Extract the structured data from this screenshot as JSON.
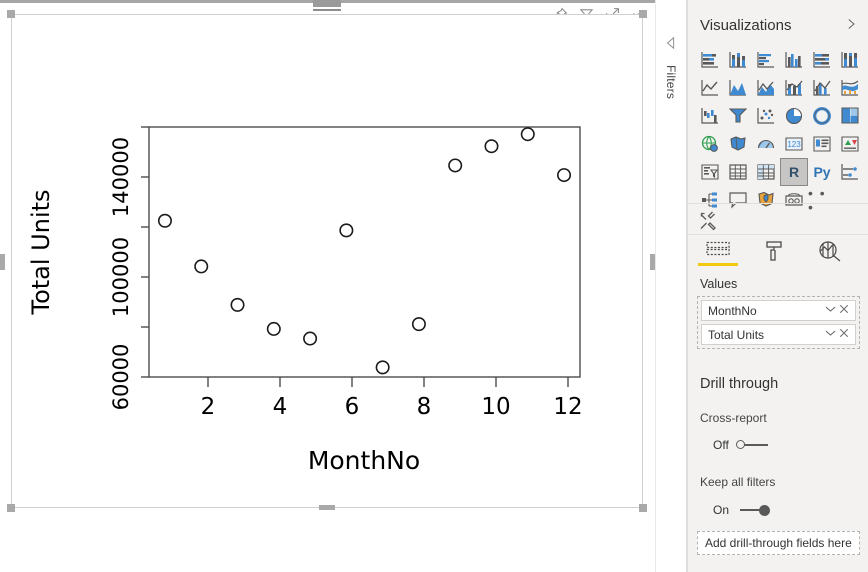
{
  "canvas": {
    "visual_header_icons": [
      "pin-icon",
      "filter-icon",
      "focus-mode-icon",
      "more-options-icon"
    ],
    "drag_handle": "drag-handle"
  },
  "filters_flyout": {
    "label": "Filters",
    "chevron": "chevron-left-icon"
  },
  "visualizations": {
    "title": "Visualizations",
    "collapse_icon": "chevron-right-icon",
    "gallery": [
      {
        "name": "stacked-bar-chart",
        "selected": false
      },
      {
        "name": "stacked-column-chart",
        "selected": false
      },
      {
        "name": "clustered-bar-chart",
        "selected": false
      },
      {
        "name": "clustered-column-chart",
        "selected": false
      },
      {
        "name": "100-percent-stacked-bar-chart",
        "selected": false
      },
      {
        "name": "100-percent-stacked-column-chart",
        "selected": false
      },
      {
        "name": "line-chart",
        "selected": false
      },
      {
        "name": "area-chart",
        "selected": false
      },
      {
        "name": "stacked-area-chart",
        "selected": false
      },
      {
        "name": "line-and-stacked-column-chart",
        "selected": false
      },
      {
        "name": "line-and-clustered-column-chart",
        "selected": false
      },
      {
        "name": "ribbon-chart",
        "selected": false
      },
      {
        "name": "waterfall-chart",
        "selected": false
      },
      {
        "name": "funnel-chart",
        "selected": false
      },
      {
        "name": "scatter-chart",
        "selected": false
      },
      {
        "name": "pie-chart",
        "selected": false
      },
      {
        "name": "donut-chart",
        "selected": false
      },
      {
        "name": "treemap-chart",
        "selected": false
      },
      {
        "name": "map-visual",
        "selected": false
      },
      {
        "name": "filled-map-visual",
        "selected": false
      },
      {
        "name": "gauge-visual",
        "selected": false
      },
      {
        "name": "card-visual",
        "selected": false
      },
      {
        "name": "multi-row-card-visual",
        "selected": false
      },
      {
        "name": "kpi-visual",
        "selected": false
      },
      {
        "name": "slicer-visual",
        "selected": false
      },
      {
        "name": "table-visual",
        "selected": false
      },
      {
        "name": "matrix-visual",
        "selected": false
      },
      {
        "name": "r-script-visual",
        "selected": true,
        "label": "R"
      },
      {
        "name": "python-script-visual",
        "selected": false,
        "label": "Py"
      },
      {
        "name": "key-influencers-visual",
        "selected": false
      },
      {
        "name": "decomposition-tree-visual",
        "selected": false
      },
      {
        "name": "qna-visual",
        "selected": false
      },
      {
        "name": "arcgis-maps-visual",
        "selected": false
      },
      {
        "name": "paginated-report-visual",
        "selected": false
      },
      {
        "name": "more-visuals",
        "selected": false,
        "label": "• • •"
      }
    ],
    "tools_icon": "format-tools-icon",
    "well_tabs": [
      {
        "name": "fields-tab",
        "icon": "fields-icon",
        "active": true
      },
      {
        "name": "format-tab",
        "icon": "paint-roller-icon",
        "active": false
      },
      {
        "name": "analytics-tab",
        "icon": "analytics-magnifier-icon",
        "active": false
      }
    ],
    "well_heading": "Values",
    "fields": [
      {
        "label": "MonthNo",
        "dropdown_icon": "chevron-down-icon",
        "remove_icon": "close-icon"
      },
      {
        "label": "Total Units",
        "dropdown_icon": "chevron-down-icon",
        "remove_icon": "close-icon"
      }
    ]
  },
  "drill_through": {
    "title": "Drill through",
    "cross_report_label": "Cross-report",
    "cross_report_state": "Off",
    "keep_all_filters_label": "Keep all filters",
    "keep_all_filters_state": "On",
    "dropzone_placeholder": "Add drill-through fields here"
  },
  "chart_data": {
    "type": "scatter",
    "title": "",
    "xlabel": "MonthNo",
    "ylabel": "Total Units",
    "x": [
      1,
      2,
      3,
      4,
      5,
      6,
      7,
      8,
      9,
      10,
      11,
      12
    ],
    "values": [
      123000,
      104000,
      88000,
      78000,
      74000,
      119000,
      62000,
      80000,
      146000,
      154000,
      159000,
      142000
    ],
    "xlim": [
      0.56,
      12.44
    ],
    "ylim": [
      58000,
      162000
    ],
    "xticks": [
      2,
      4,
      6,
      8,
      10,
      12
    ],
    "xtick_labels": [
      "2",
      "4",
      "6",
      "8",
      "10",
      "12"
    ],
    "yticks": [
      60000,
      80000,
      100000,
      120000,
      140000,
      160000
    ],
    "ytick_labels": [
      "60000",
      "",
      "100000",
      "",
      "140000",
      ""
    ],
    "grid": false,
    "legend": "none",
    "point_marker": "open-circle"
  }
}
